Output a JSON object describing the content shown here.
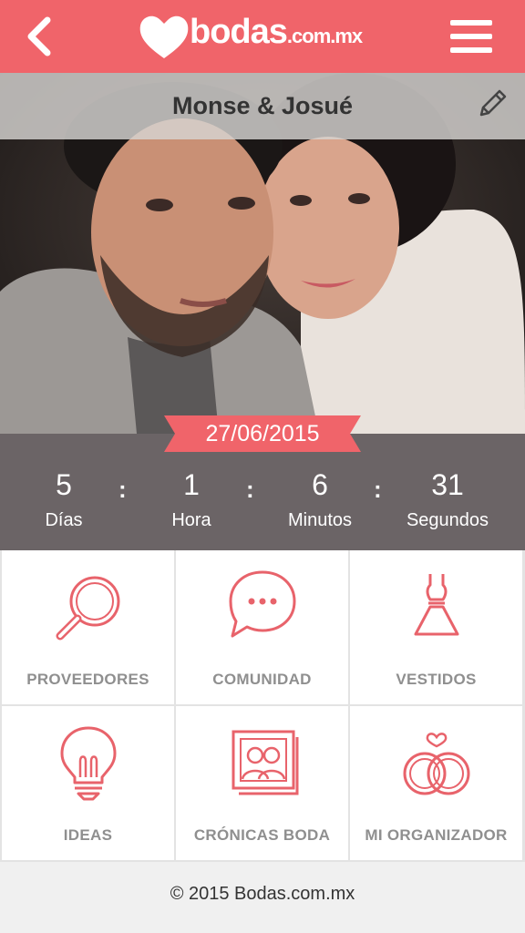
{
  "header": {
    "brand": "bodas",
    "brand_suffix": ".com.mx",
    "back_icon": "chevron-left-icon",
    "menu_icon": "hamburger-icon",
    "color": "#f0646a"
  },
  "couple": {
    "names": "Monse & Josué",
    "edit_icon": "pencil-icon"
  },
  "wedding_date": "27/06/2015",
  "countdown": [
    {
      "value": "5",
      "label": "Días"
    },
    {
      "value": "1",
      "label": "Hora"
    },
    {
      "value": "6",
      "label": "Minutos"
    },
    {
      "value": "31",
      "label": "Segundos"
    }
  ],
  "menu": [
    {
      "label": "PROVEEDORES",
      "icon": "magnifier-icon"
    },
    {
      "label": "COMUNIDAD",
      "icon": "chat-bubble-icon"
    },
    {
      "label": "VESTIDOS",
      "icon": "dress-icon"
    },
    {
      "label": "IDEAS",
      "icon": "lightbulb-icon"
    },
    {
      "label": "CRÓNICAS BODA",
      "icon": "photo-frame-icon"
    },
    {
      "label": "MI ORGANIZADOR",
      "icon": "rings-icon"
    }
  ],
  "footer": {
    "copyright": "© 2015 Bodas.com.mx"
  }
}
